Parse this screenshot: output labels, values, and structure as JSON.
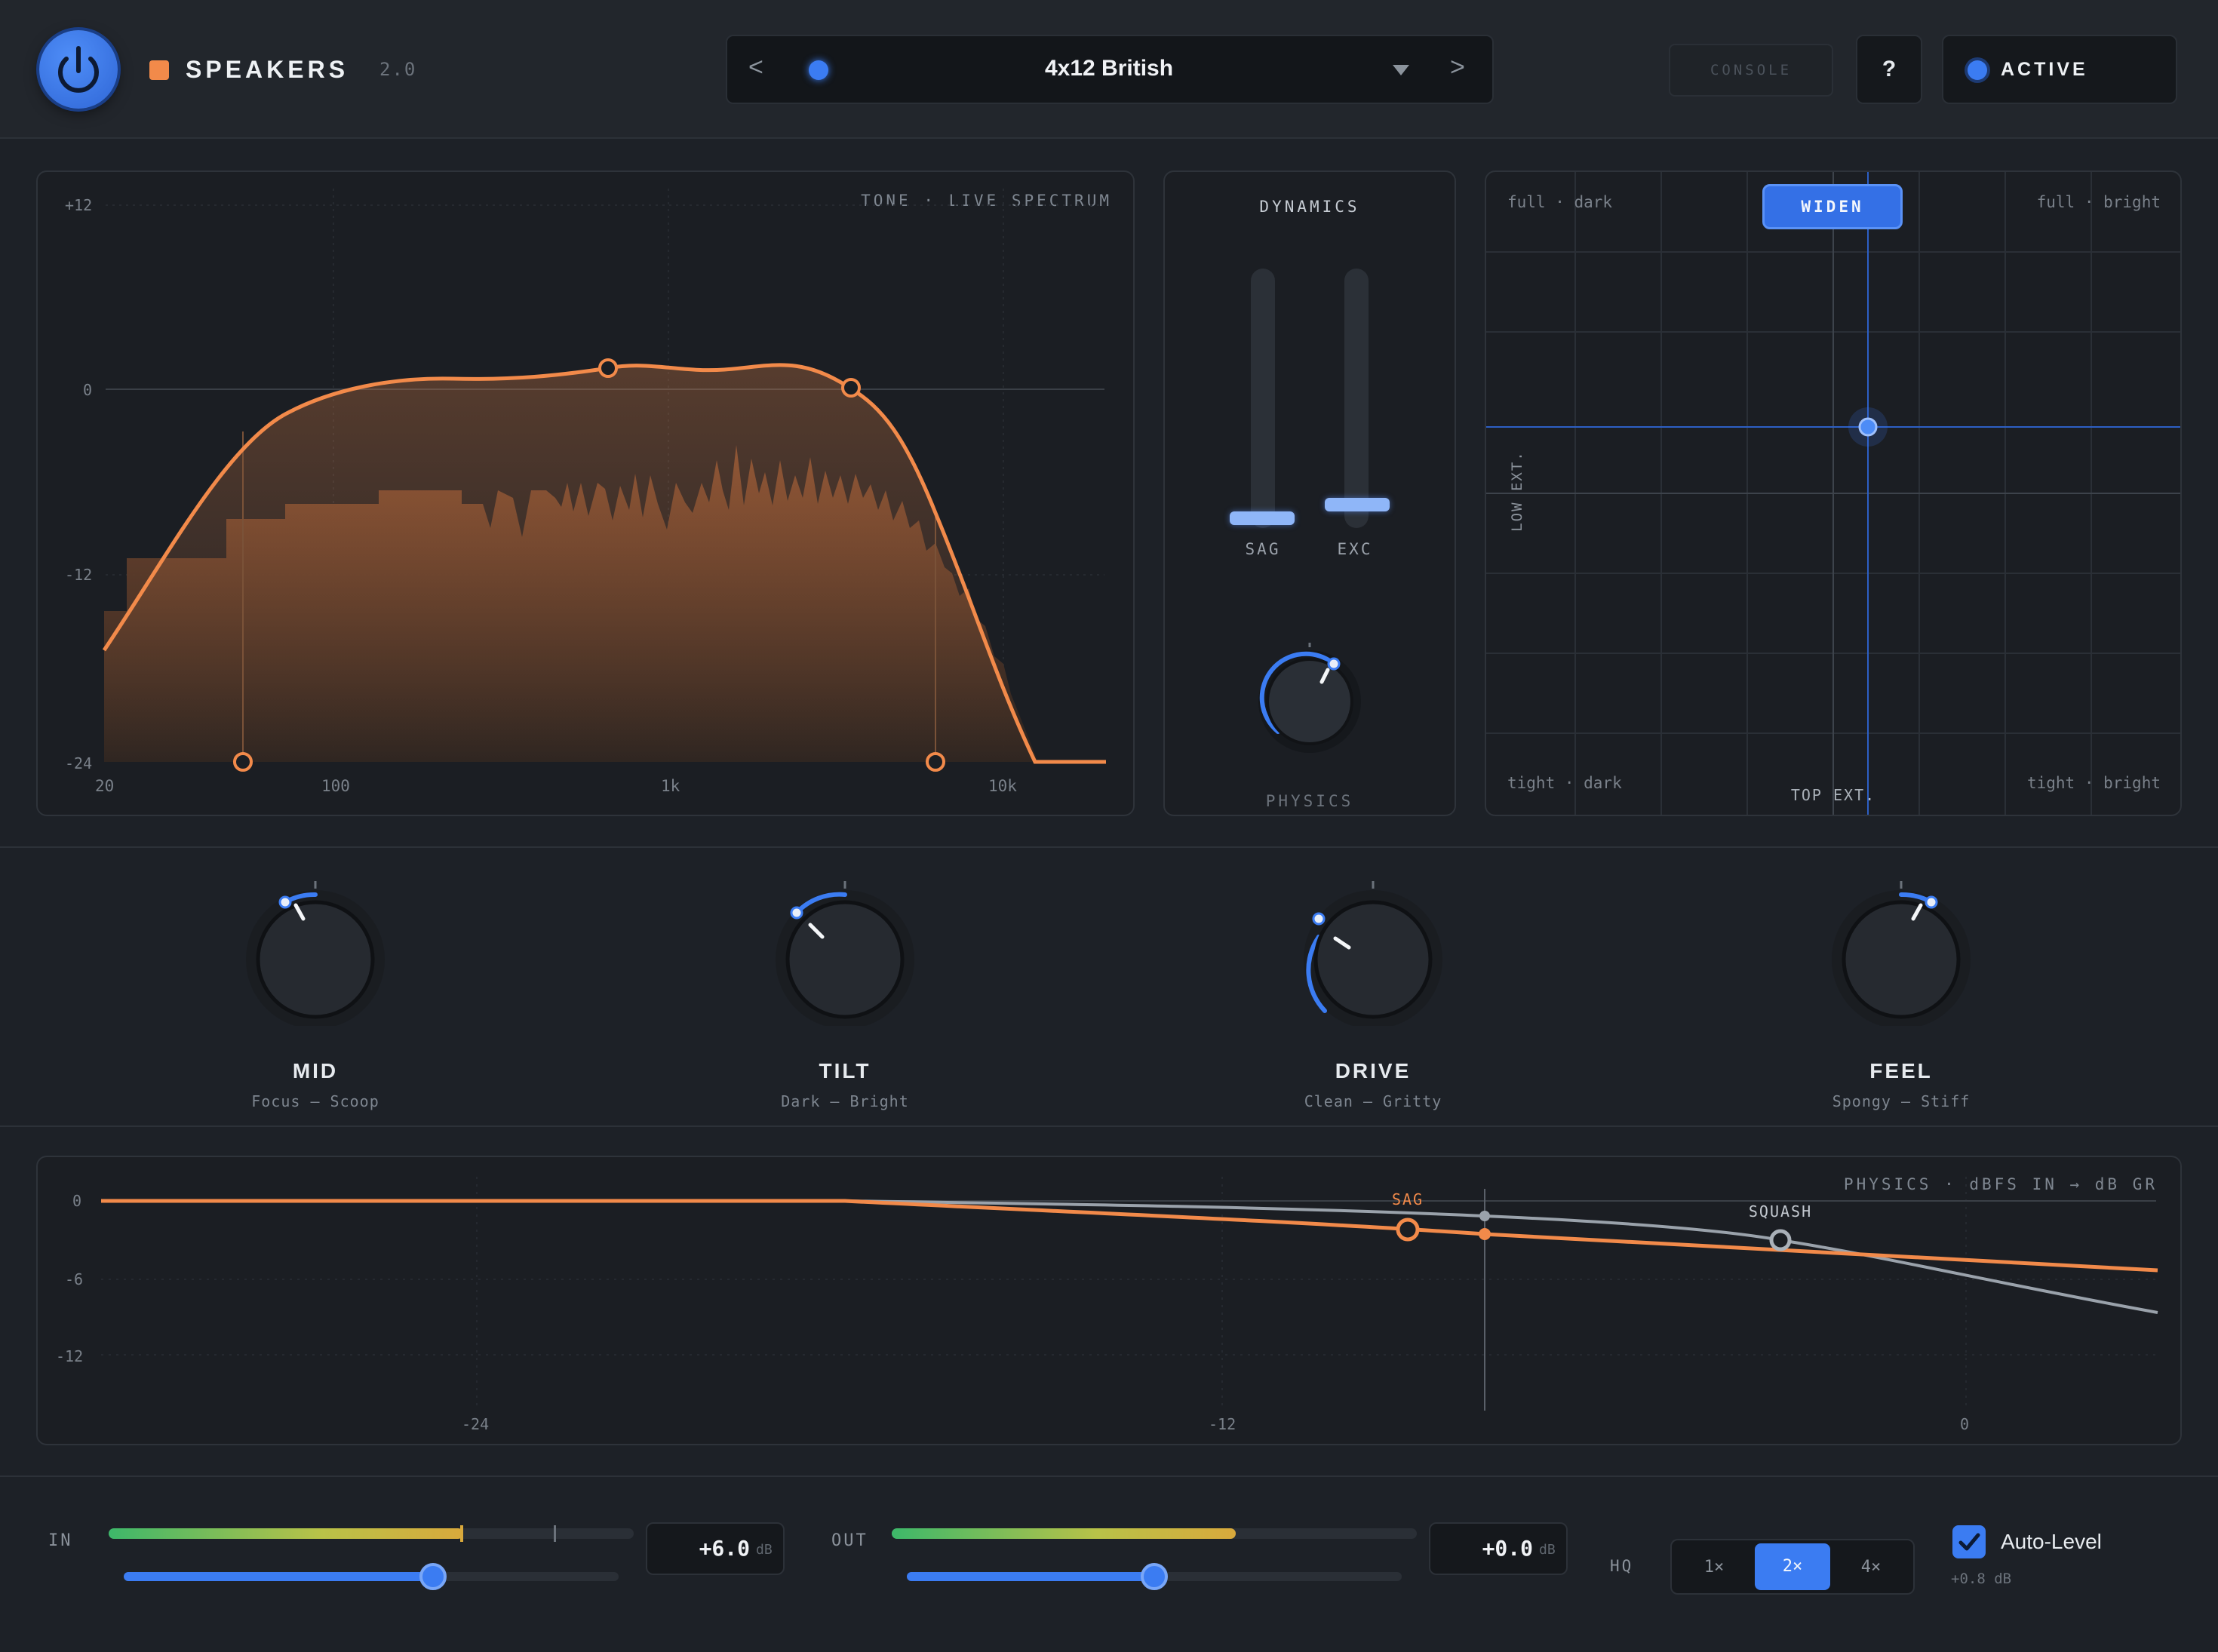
{
  "header": {
    "title": "SPEAKERS",
    "version": "2.0",
    "preset_name": "4x12 British",
    "prev_label": "<",
    "next_label": ">",
    "console_label": "CONSOLE",
    "help_label": "?",
    "active_label": "ACTIVE",
    "accent_color": "#f28a4a",
    "blue_color": "#3b7cf2"
  },
  "tone": {
    "panel_label": "TONE · LIVE SPECTRUM",
    "y_ticks": [
      "+12",
      "0",
      "-12",
      "-24"
    ],
    "x_ticks": [
      "20",
      "100",
      "1k",
      "10k"
    ]
  },
  "dynamics": {
    "title": "DYNAMICS",
    "sliders": [
      {
        "label": "SAG",
        "value": 0.0
      },
      {
        "label": "EXC",
        "value": 0.05
      }
    ],
    "knob_label": "PHYSICS",
    "knob_value": 0.72
  },
  "xy_pad": {
    "top_left": "full · dark",
    "top_right": "full · bright",
    "bottom_left": "tight · dark",
    "bottom_right": "tight · bright",
    "y_axis": "LOW EXT.",
    "x_axis": "TOP EXT.",
    "button": "WIDEN"
  },
  "knobs": [
    {
      "name": "MID",
      "range": "Focus — Scoop",
      "value": 0.42
    },
    {
      "name": "TILT",
      "range": "Dark — Bright",
      "value": 0.36
    },
    {
      "name": "DRIVE",
      "range": "Clean — Gritty",
      "value": 0.28
    },
    {
      "name": "FEEL",
      "range": "Spongy — Stiff",
      "value": 0.58
    }
  ],
  "physics_curve": {
    "panel_label": "PHYSICS · dBFS IN → dB GR",
    "y_ticks": [
      "0",
      "-6",
      "-12"
    ],
    "x_ticks": [
      "-24",
      "-12",
      "0"
    ],
    "sag_label": "SAG",
    "squash_label": "SQUASH"
  },
  "footer": {
    "in_label": "IN",
    "in_value": "+6.0",
    "in_unit": "dB",
    "in_meter": 0.68,
    "in_gain": 0.62,
    "out_label": "OUT",
    "out_value": "+0.0",
    "out_unit": "dB",
    "out_meter": 0.66,
    "out_gain": 0.5,
    "hq_label": "HQ",
    "hq_options": [
      "1×",
      "2×",
      "4×"
    ],
    "hq_selected": "2×",
    "auto_level_label": "Auto-Level",
    "auto_level_value": "+0.8 dB"
  }
}
